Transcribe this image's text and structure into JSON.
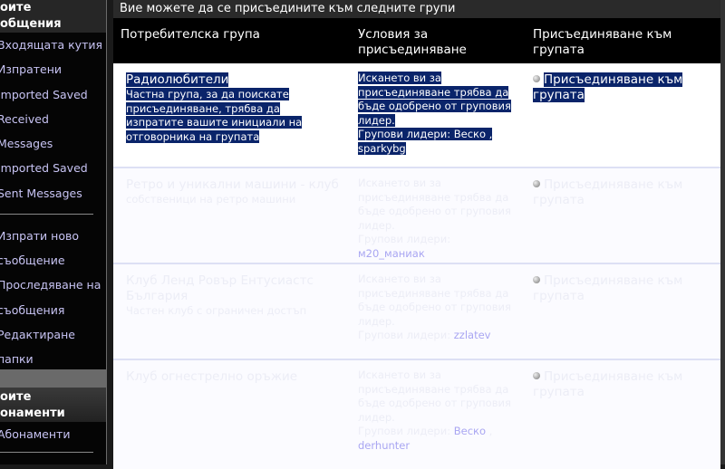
{
  "sidebar": {
    "section1_title": "оите\nобщения",
    "items1": [
      "Входящата кутия",
      "Изпратени",
      "Imported Saved",
      "Received",
      "Messages",
      "Imported Saved",
      "Sent Messages"
    ],
    "items2": [
      "Изпрати ново",
      "съобщение",
      "Проследяване на",
      "съобщения",
      "Редактиране",
      "папки"
    ],
    "section2_title": "оите\nонаменти",
    "items3": [
      "Абонаменти"
    ]
  },
  "main": {
    "title": "Вие можете да се присъедините към следните групи",
    "headers": [
      "Потребителска група",
      "Условия за присъединяване",
      "Присъединяване към групата"
    ],
    "leaders_label": "Групови лидери:",
    "join_label": "Присъединяване към групата",
    "rows": [
      {
        "name": "Радиолюбители",
        "desc": "Частна група, за да поискате присъединяване, трябва да изпратите вашите инициали на отговорника на групата",
        "cond": "Искането ви за присъединяване трябва да бъде одобрено от груповия лидер.",
        "leaders": "Веско , sparkybg"
      },
      {
        "name": "Ретро и уникални машини - клуб",
        "desc": "собственици на ретро машини",
        "cond": "Искането ви за присъединяване трябва да бъде одобрено от груповия лидер.",
        "leaders": "м20_маниак"
      },
      {
        "name": "Клуб Ленд Ровър Ентусиастс България",
        "desc": "Частен клуб с ограничен достъп",
        "cond": "Искането ви за присъединяване трябва да бъде одобрено от груповия лидер.",
        "leaders": "zzlatev"
      },
      {
        "name": "Клуб огнестрелно оръжие",
        "desc": "",
        "cond": "Искането ви за присъединяване трябва да бъде одобрено от груповия лидер.",
        "leaders_a": "Веско",
        "leaders_b": "derhunter"
      }
    ]
  }
}
